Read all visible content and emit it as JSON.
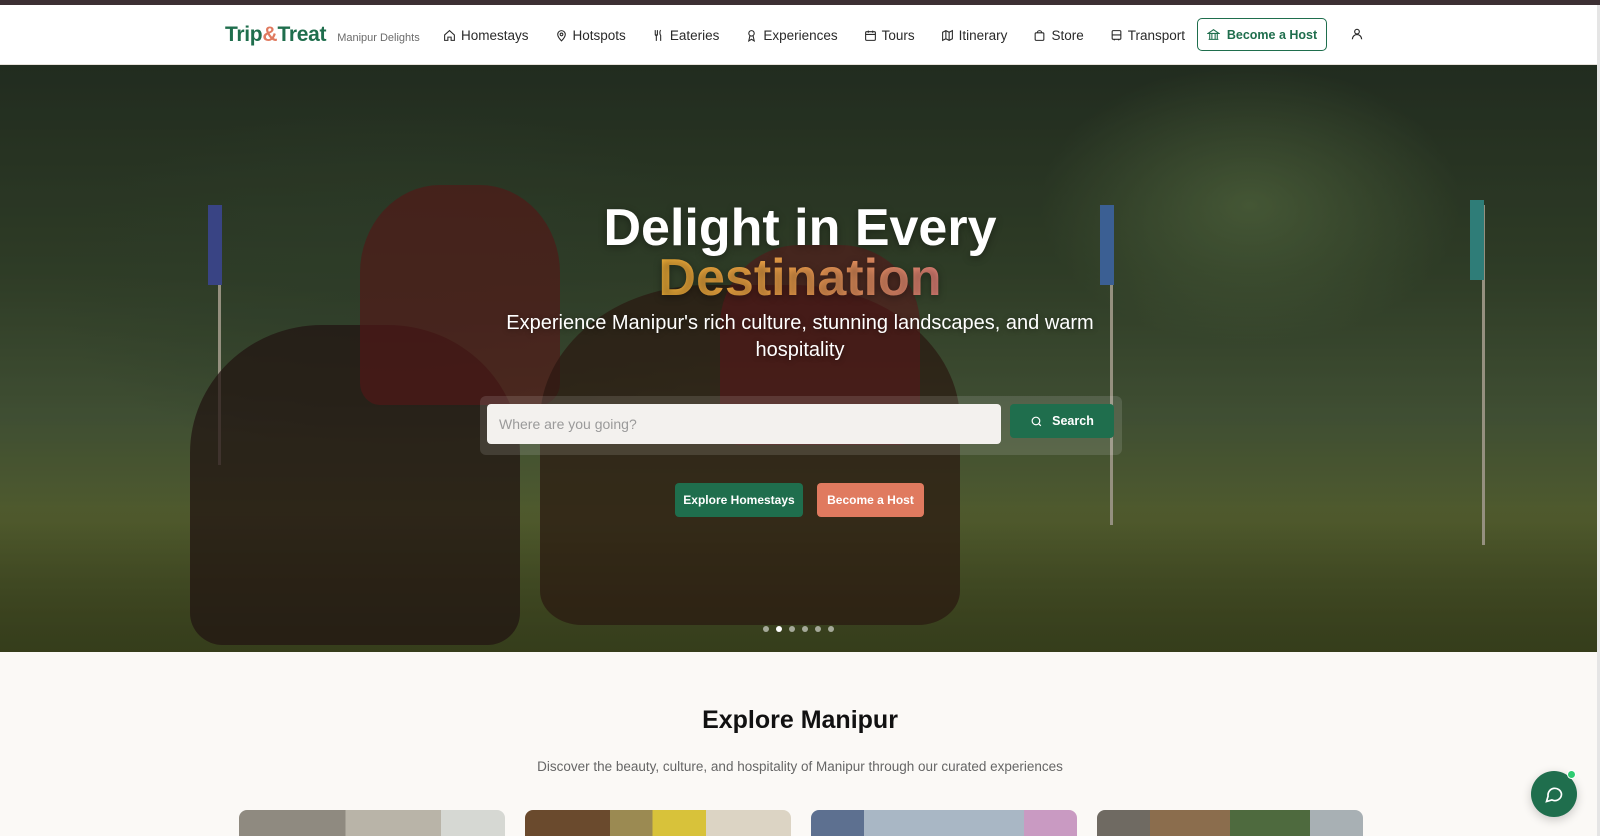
{
  "brand": {
    "name_part1": "Trip",
    "name_amp": "&",
    "name_part2": "Treat",
    "tagline": "Manipur Delights"
  },
  "nav": [
    {
      "label": "Homestays",
      "icon": "home-icon"
    },
    {
      "label": "Hotspots",
      "icon": "map-pin-icon"
    },
    {
      "label": "Eateries",
      "icon": "utensils-icon"
    },
    {
      "label": "Experiences",
      "icon": "award-icon"
    },
    {
      "label": "Tours",
      "icon": "calendar-icon"
    },
    {
      "label": "Itinerary",
      "icon": "map-icon"
    },
    {
      "label": "Store",
      "icon": "shopping-bag-icon"
    },
    {
      "label": "Transport",
      "icon": "bus-icon"
    }
  ],
  "header": {
    "host_button": "Become a Host",
    "host_icon": "landmark-icon",
    "user_icon": "user-icon"
  },
  "hero": {
    "title_line1": "Delight in Every",
    "title_accent": "Destination",
    "subtitle": "Experience Manipur's rich culture, stunning landscapes, and warm hospitality",
    "search_placeholder": "Where are you going?",
    "search_button": "Search",
    "cta_primary": "Explore Homestays",
    "cta_secondary": "Become a Host",
    "slides_total": 6,
    "active_slide": 2
  },
  "explore": {
    "title": "Explore Manipur",
    "subtitle": "Discover the beauty, culture, and hospitality of Manipur through our curated experiences"
  },
  "colors": {
    "primary": "#1f6e4d",
    "accent": "#e07a5f",
    "gold": "#f2b138"
  }
}
